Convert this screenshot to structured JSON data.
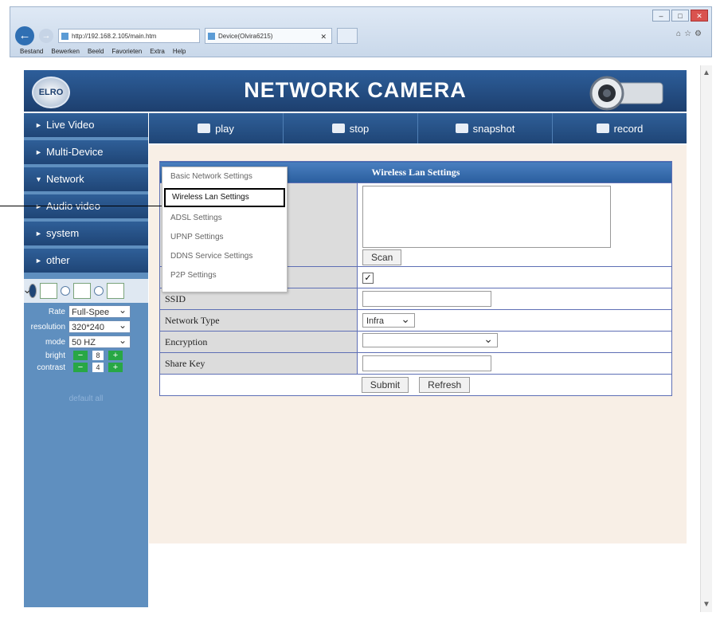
{
  "browser": {
    "address": "http://192.168.2.105/main.htm",
    "tab_title": "Device(Olvira6215)",
    "menu": [
      "Bestand",
      "Bewerken",
      "Beeld",
      "Favorieten",
      "Extra",
      "Help"
    ]
  },
  "header": {
    "logo": "ELRO",
    "title": "NETWORK CAMERA"
  },
  "sidebar": {
    "items": [
      {
        "label": "Live Video",
        "open": false
      },
      {
        "label": "Multi-Device",
        "open": false
      },
      {
        "label": "Network",
        "open": true
      },
      {
        "label": "Audio video",
        "open": false
      },
      {
        "label": "system",
        "open": false
      },
      {
        "label": "other",
        "open": false
      }
    ],
    "controls": [
      {
        "label": "Rate",
        "value": "Full-Spee"
      },
      {
        "label": "resolution",
        "value": "320*240"
      },
      {
        "label": "mode",
        "value": "50 HZ"
      }
    ],
    "adjust": [
      {
        "label": "bright",
        "value": "8"
      },
      {
        "label": "contrast",
        "value": "4"
      }
    ],
    "default_all": "default all"
  },
  "toolbar": [
    "play",
    "stop",
    "snapshot",
    "record"
  ],
  "submenu": [
    "Basic Network Settings",
    "Wireless Lan Settings",
    "ADSL Settings",
    "UPNP Settings",
    "DDNS Service Settings",
    "P2P Settings"
  ],
  "form": {
    "title": "Wireless Lan Settings",
    "scan_button": "Scan",
    "ssid_label": "SSID",
    "network_type_label": "Network Type",
    "network_type_value": "Infra",
    "encryption_label": "Encryption",
    "share_key_label": "Share Key",
    "submit": "Submit",
    "refresh": "Refresh"
  }
}
